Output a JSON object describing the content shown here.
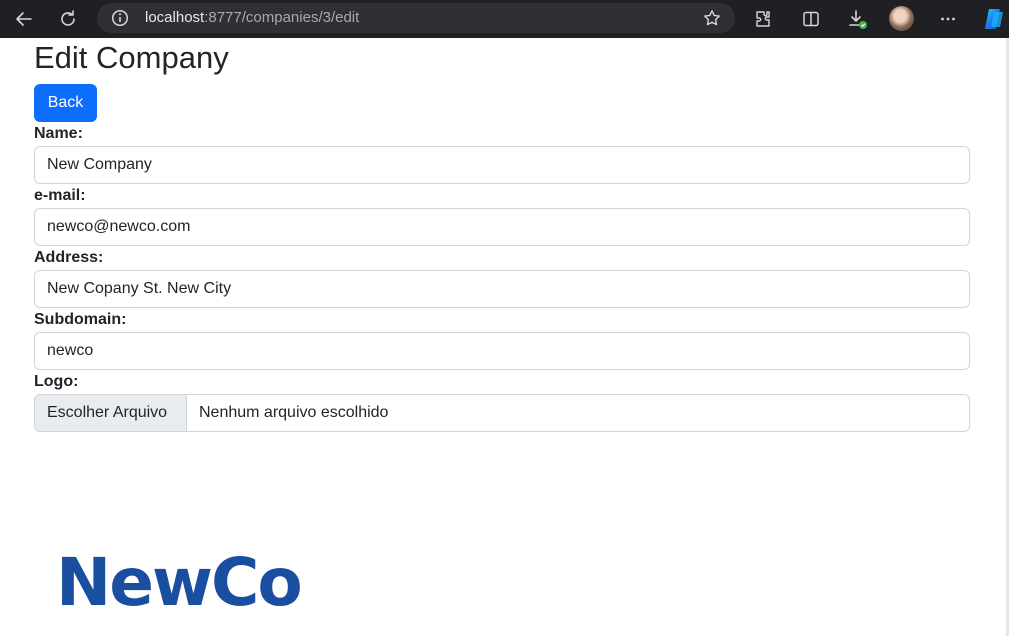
{
  "browser": {
    "url_host": "localhost",
    "url_path": ":8777/companies/3/edit",
    "icons": [
      "back-arrow-icon",
      "reload-icon",
      "info-icon",
      "star-icon",
      "extensions-icon",
      "split-screen-icon",
      "downloads-icon",
      "profile-avatar",
      "more-icon",
      "copilot-icon"
    ]
  },
  "page": {
    "title": "Edit Company",
    "back_label": "Back"
  },
  "form": {
    "name": {
      "label": "Name:",
      "value": "New Company"
    },
    "email": {
      "label": "e-mail:",
      "value": "newco@newco.com"
    },
    "address": {
      "label": "Address:",
      "value": "New Copany St. New City"
    },
    "subdomain": {
      "label": "Subdomain:",
      "value": "newco"
    },
    "logo": {
      "label": "Logo:",
      "button_label": "Escolher Arquivo",
      "status": "Nenhum arquivo escolhido"
    }
  },
  "logo_image": {
    "text": "NewCo",
    "color": "#1a4ea0"
  },
  "colors": {
    "primary": "#0d6efd",
    "chrome": "#1f2023"
  }
}
